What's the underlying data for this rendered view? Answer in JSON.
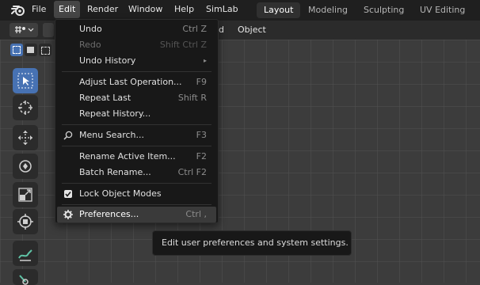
{
  "menubar": {
    "items": [
      "File",
      "Edit",
      "Render",
      "Window",
      "Help",
      "SimLab"
    ],
    "active": "Edit"
  },
  "workspaces": {
    "tabs": [
      "Layout",
      "Modeling",
      "Sculpting",
      "UV Editing"
    ],
    "active": "Layout"
  },
  "viewport_header": {
    "menu_partial_1": "ld",
    "menu_object": "Object"
  },
  "edit_menu": {
    "items": [
      {
        "label": "Undo",
        "shortcut": "Ctrl Z",
        "enabled": true
      },
      {
        "label": "Redo",
        "shortcut": "Shift Ctrl Z",
        "enabled": false
      },
      {
        "label": "Undo History",
        "shortcut": "▸",
        "enabled": true
      },
      {
        "label": "Adjust Last Operation...",
        "shortcut": "F9",
        "enabled": true
      },
      {
        "label": "Repeat Last",
        "shortcut": "Shift R",
        "enabled": true
      },
      {
        "label": "Repeat History...",
        "shortcut": "",
        "enabled": true
      },
      {
        "label": "Menu Search...",
        "shortcut": "F3",
        "enabled": true,
        "icon": "search-icon"
      },
      {
        "label": "Rename Active Item...",
        "shortcut": "F2",
        "enabled": true
      },
      {
        "label": "Batch Rename...",
        "shortcut": "Ctrl F2",
        "enabled": true
      },
      {
        "label": "Lock Object Modes",
        "shortcut": "",
        "enabled": true,
        "icon": "checkbox-checked-icon"
      },
      {
        "label": "Preferences...",
        "shortcut": "Ctrl ,",
        "enabled": true,
        "icon": "gear-icon",
        "hovered": true
      }
    ]
  },
  "tooltip": {
    "text": "Edit user preferences and system settings."
  },
  "toolbar": {
    "tools": [
      "select-box-icon",
      "cursor-icon",
      "move-icon",
      "rotate-icon",
      "scale-icon",
      "transform-icon",
      "annotate-icon",
      "measure-icon"
    ],
    "active": "select-box-icon"
  },
  "colors": {
    "accent": "#4772b3",
    "menu_bg": "#181818",
    "topbar_bg": "#1f1f1f",
    "viewport_bg": "#3c3c3c"
  }
}
